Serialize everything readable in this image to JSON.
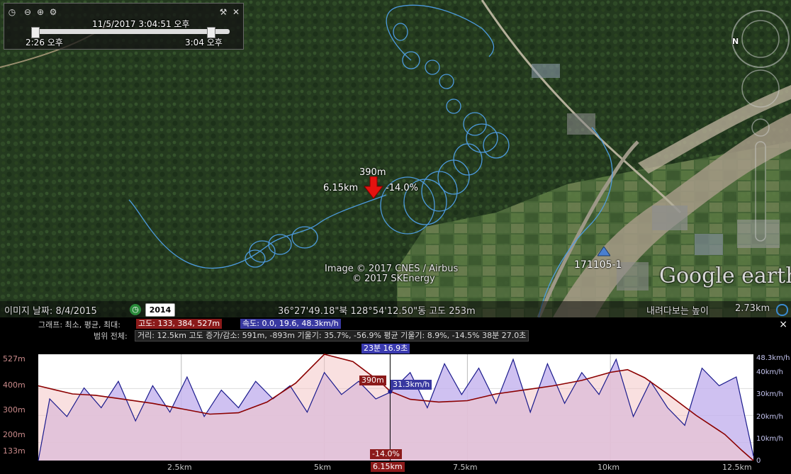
{
  "time_slider": {
    "current": "11/5/2017    3:04:51 오후",
    "start": "2:26 오후",
    "end": "3:04 오후"
  },
  "map": {
    "marker": {
      "altitude": "390m",
      "distance": "6.15km",
      "grade": "-14.0%"
    },
    "placemark_label": "171105-1",
    "attribution_1": "Image © 2017 CNES / Airbus",
    "attribution_2": "© 2017 SKEnergy",
    "logo": "Google earth",
    "compass_letter": "N"
  },
  "status_bar": {
    "imagery_date": "이미지 날짜: 8/4/2015",
    "historical_year": "2014",
    "coordinates": "36°27'49.18\"북 128°54'12.50\"동 고도  253m",
    "eye_alt_label": "내려다보는 높이",
    "eye_alt_value": "2.73km"
  },
  "profile": {
    "graph_label": "그래프: 최소, 평균, 최대:",
    "alt_stats": "고도: 133, 384, 527m",
    "speed_stats": "속도: 0.0, 19.6, 48.3km/h",
    "range_label": "범위 전체:",
    "range_stats": "거리: 12.5km 고도 증가/감소: 591m, -893m 기울기: 35.7%, -56.9% 평균 기울기: 8.9%, -14.5% 38분 27.0초",
    "time_marker": "23분 16.9초",
    "alt_marker": "390m",
    "speed_marker": "31.3km/h",
    "grade_marker": "-14.0%",
    "dist_marker": "6.15km",
    "close": "×",
    "colors": {
      "altitude_line": "#8b0000",
      "altitude_fill": "#f4c6c6",
      "speed_line": "#1a1a8c",
      "speed_fill": "#c7b6ee"
    }
  },
  "chart_data": {
    "type": "line",
    "x_unit": "km",
    "xlim": [
      0,
      12.5
    ],
    "x_ticks": [
      "2.5km",
      "5km",
      "6.15km",
      "7.5km",
      "10km",
      "12.5km"
    ],
    "y_left_ticks": [
      "527m",
      "400m",
      "300m",
      "200m",
      "133m"
    ],
    "y_left_lim": [
      133,
      527
    ],
    "y_right_ticks": [
      "48.3km/h",
      "40km/h",
      "30km/h",
      "20km/h",
      "10km/h",
      "0"
    ],
    "y_right_lim": [
      0,
      48.3
    ],
    "series": [
      {
        "name": "고도",
        "unit": "m",
        "x": [
          0,
          0.3,
          0.6,
          1,
          1.5,
          2,
          2.5,
          3,
          3.5,
          4,
          4.5,
          5,
          5.5,
          6,
          6.15,
          6.5,
          7,
          7.5,
          8,
          8.5,
          9,
          9.5,
          10,
          10.3,
          10.6,
          11,
          11.5,
          12,
          12.3,
          12.5
        ],
        "values": [
          410,
          395,
          380,
          375,
          360,
          345,
          325,
          305,
          310,
          350,
          420,
          527,
          500,
          420,
          390,
          360,
          350,
          355,
          380,
          395,
          410,
          430,
          460,
          470,
          440,
          380,
          300,
          230,
          170,
          133
        ]
      },
      {
        "name": "속도",
        "unit": "km/h",
        "x": [
          0,
          0.2,
          0.5,
          0.8,
          1.1,
          1.4,
          1.7,
          2,
          2.3,
          2.6,
          2.9,
          3.2,
          3.5,
          3.8,
          4.1,
          4.4,
          4.7,
          5,
          5.3,
          5.6,
          5.9,
          6.15,
          6.5,
          6.8,
          7.1,
          7.4,
          7.7,
          8,
          8.3,
          8.6,
          8.9,
          9.2,
          9.5,
          9.8,
          10.1,
          10.4,
          10.7,
          11,
          11.3,
          11.6,
          11.9,
          12.2,
          12.5
        ],
        "values": [
          0,
          28,
          20,
          33,
          24,
          36,
          18,
          34,
          22,
          38,
          20,
          32,
          24,
          36,
          28,
          34,
          22,
          40,
          30,
          36,
          28,
          31,
          40,
          24,
          44,
          30,
          42,
          26,
          46,
          22,
          44,
          26,
          40,
          30,
          46,
          20,
          36,
          24,
          16,
          42,
          34,
          38,
          2
        ]
      }
    ]
  }
}
